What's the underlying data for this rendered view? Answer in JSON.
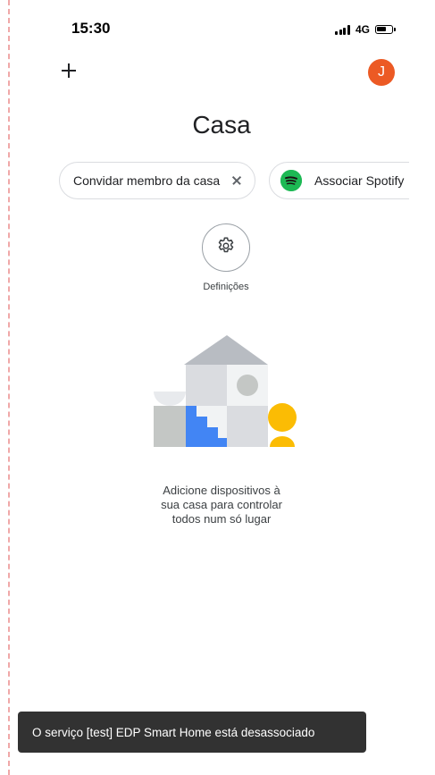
{
  "status_bar": {
    "time": "15:30",
    "network": "4G"
  },
  "header": {
    "add_icon": "plus-icon",
    "avatar_letter": "J",
    "avatar_color": "#ec5a24",
    "title": "Casa"
  },
  "chips": {
    "invite": {
      "label": "Convidar membro da casa",
      "close_icon": "close-icon"
    },
    "spotify": {
      "label": "Associar Spotify",
      "icon": "spotify-icon",
      "icon_color": "#1db954"
    }
  },
  "settings": {
    "icon": "gear-icon",
    "label": "Definições"
  },
  "empty_state": {
    "illustration": "house-illustration",
    "lines": [
      "Adicione dispositivos à",
      "sua casa para controlar",
      "todos num só lugar"
    ]
  },
  "snackbar": {
    "message": "O serviço [test] EDP Smart Home está desassociado"
  }
}
